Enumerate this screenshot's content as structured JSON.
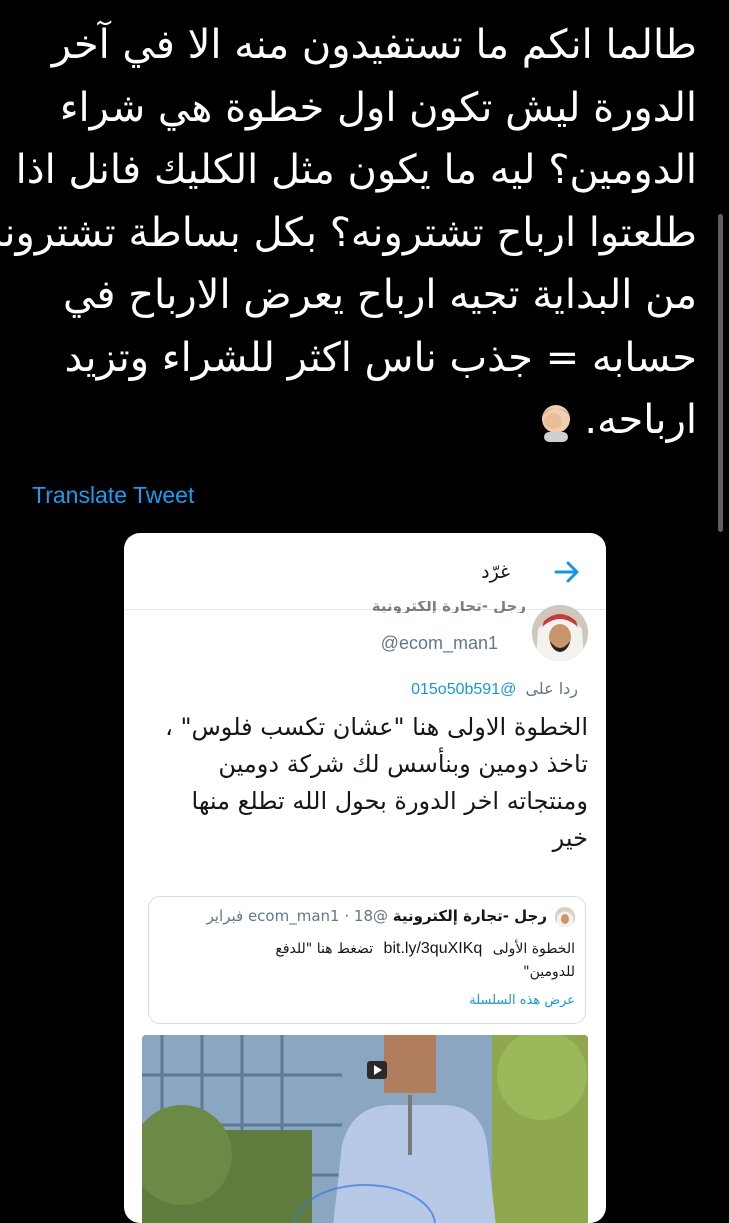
{
  "tweet": {
    "lines": [
      "طالما انكم ما تستفيدون منه الا في آخر",
      "الدورة ليش تكون اول خطوة هي شراء",
      "الدومين؟ ليه ما يكون مثل الكليك فانل اذا",
      "طلعتوا ارباح تشترونه؟ بكل بساطة تشترونه",
      "من البداية تجيه ارباح يعرض الارباح في",
      "حسابه = جذب ناس اكثر للشراء وتزيد",
      "ارباحه."
    ],
    "emoji": "facepalm-emoji",
    "translate_label": "Translate Tweet"
  },
  "screenshot_card": {
    "header": {
      "title": "غرّد",
      "back_icon": "arrow-icon"
    },
    "author": {
      "name_clipped": "رجل -تجارة إلكترونية",
      "handle": "@ecom_man1"
    },
    "reply": {
      "prefix": "ردا على",
      "mention": "@015o50b591"
    },
    "body_lines": [
      "الخطوة الاولى هنا \"عشان تكسب فلوس\" ،",
      "تاخذ دومين وبنأسس لك شركة دومين",
      "ومنتجاته اخر الدورة بحول الله تطلع منها",
      "خير"
    ],
    "quote": {
      "name": "رجل -تجارة إلكترونية",
      "handle": "@ecom_man1",
      "separator": "·",
      "date": "18 فبراير",
      "text_prefix": "الخطوة الأولى",
      "link": "bit.ly/3quXIKq",
      "text_suffix": "تضغط هنا \"للدفع",
      "text_line2": "للدومين\"",
      "show_thread": "عرض هذه السلسلة"
    }
  },
  "colors": {
    "background": "#000000",
    "link_blue": "#1d9bf0",
    "card_bg": "#ffffff"
  }
}
